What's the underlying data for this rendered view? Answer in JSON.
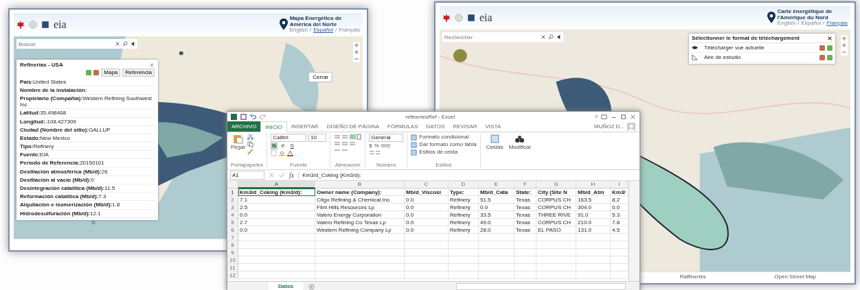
{
  "map_windows": [
    {
      "kind": "left",
      "logo_text": "eia",
      "title_lines": [
        "Mapa Energético de",
        "América del Norte"
      ],
      "language_separator": "/",
      "languages": [
        {
          "label": "English",
          "selected": false
        },
        {
          "label": "Español",
          "selected": true
        },
        {
          "label": "Français",
          "selected": false
        }
      ],
      "search": {
        "placeholder": "Buscar"
      },
      "info_panel": {
        "title": "Refinerías - USA",
        "buttons": [
          "Mapa",
          "Referencia"
        ],
        "fields": [
          {
            "label": "País:",
            "value": "United States"
          },
          {
            "label": "Nombre de la instalación:"
          },
          {
            "label": "Propietario (Compañía):",
            "value": "Western Refining Southwest Inc"
          },
          {
            "label": "Latitud:",
            "value": "35.498468"
          },
          {
            "label": "Longitud:",
            "value": "-108.427309"
          },
          {
            "label": "Ciudad (Nombre del sitio):",
            "value": "GALLUP"
          },
          {
            "label": "Estado:",
            "value": "New Mexico"
          },
          {
            "label": "Tipo:",
            "value": "Refinery"
          },
          {
            "label": "Fuente:",
            "value": "EIA"
          },
          {
            "label": "Período de Referencia:",
            "value": "20150101"
          },
          {
            "label": "Destilación atmosférica (Mb/d):",
            "value": "26"
          },
          {
            "label": "Destilación al vacío (Mb/d):",
            "value": "0"
          },
          {
            "label": "Desintegración catalítica (Mb/d):",
            "value": "11.5"
          },
          {
            "label": "Reformación catalítica (Mb/d):",
            "value": "7.3"
          },
          {
            "label": "Alquilación e isomerización (Mb/d):",
            "value": "1.8"
          },
          {
            "label": "Hidrodesulfuración (Mb/d):",
            "value": "12.1"
          }
        ]
      },
      "popup_button": "Cerrar"
    },
    {
      "kind": "right",
      "logo_text": "eia",
      "title_lines": [
        "Carte énergétique de",
        "l'Amérique du Nord"
      ],
      "language_separator": "/",
      "languages": [
        {
          "label": "English",
          "selected": false
        },
        {
          "label": "Español",
          "selected": false
        },
        {
          "label": "Français",
          "selected": true
        }
      ],
      "search": {
        "placeholder": "Rechercher"
      },
      "download_panel": {
        "title": "Sélectionner le format de téléchargement",
        "rows": [
          "Télécharger vue actuelle",
          "Aire de estudio"
        ]
      },
      "footer_tabs": [
        "Raffineries",
        "Open Street Map"
      ]
    }
  ],
  "spreadsheet": {
    "title": "refineriesRef - Excel",
    "help": "?",
    "ribbon_tabs": [
      {
        "label": "ARCHIVO",
        "kind": "file",
        "selected": false
      },
      {
        "label": "INICIO",
        "kind": "tab",
        "selected": true
      },
      {
        "label": "INSERTAR",
        "kind": "tab",
        "selected": false
      },
      {
        "label": "DISEÑO DE PÁGINA",
        "kind": "tab",
        "selected": false
      },
      {
        "label": "FÓRMULAS",
        "kind": "tab",
        "selected": false
      },
      {
        "label": "DATOS",
        "kind": "tab",
        "selected": false
      },
      {
        "label": "REVISAR",
        "kind": "tab",
        "selected": false
      },
      {
        "label": "VISTA",
        "kind": "tab",
        "selected": false
      }
    ],
    "user": "MUÑOZ D...",
    "ribbon": {
      "paste": "Pegar",
      "clipboard_label": "Portapapeles",
      "font_name": "Calibri",
      "font_size": "10",
      "font_styles": [
        {
          "label": "N",
          "on": true
        },
        {
          "label": "K",
          "on": false
        },
        {
          "label": "S",
          "on": false
        }
      ],
      "font_label": "Fuente",
      "alignment_label": "Alineación",
      "number_format": "General",
      "number_symbols": [
        "$",
        "%",
        "000"
      ],
      "number_label": "Número",
      "style_items": [
        "Formato condicional",
        "Dar formato como tabla",
        "Estilos de celda"
      ],
      "styles_label": "Estilos",
      "cells_label": "Celdas",
      "editing_label": "Modificar"
    },
    "name_box": "A1",
    "formula_label": "fx",
    "formula": "Km3/d_Coking (Km3/d):",
    "columns": [
      "A",
      "B",
      "C",
      "D",
      "E",
      "F",
      "G",
      "H",
      "I"
    ],
    "rows": [
      {
        "number": "1",
        "kind": "header",
        "cells": [
          "Km3/d_Coking (Km3/d):",
          "Owner name (Company):",
          "Mb/d_Viscosi",
          "Type:",
          "Mb/d_Cata",
          "State:",
          "City (Site N",
          "Mb/d_Atm",
          "Km3/"
        ]
      },
      {
        "number": "2",
        "kind": "data",
        "cells": [
          "7.1",
          "Citgo Refining & Chemical Inc",
          "0.0",
          "Refinery",
          "51.5",
          "Texas",
          "CORPUS CH",
          "163.5",
          "8.2"
        ]
      },
      {
        "number": "3",
        "kind": "data",
        "cells": [
          "2.5",
          "Flint Hills Resources Lp",
          "0.0",
          "Refinery",
          "0.0",
          "Texas",
          "CORPUS CH",
          "304.0",
          "0.0"
        ]
      },
      {
        "number": "4",
        "kind": "data",
        "cells": [
          "0.0",
          "Valero Energy Corporation",
          "0.0",
          "Refinery",
          "33.5",
          "Texas",
          "THREE RIVE",
          "91.0",
          "5.3"
        ]
      },
      {
        "number": "5",
        "kind": "data",
        "cells": [
          "2.7",
          "Valero Refining Co Texas Lp",
          "0.0",
          "Refinery",
          "49.0",
          "Texas",
          "CORPUS CH",
          "210.0",
          "7.8"
        ]
      },
      {
        "number": "6",
        "kind": "data",
        "cells": [
          "0.0",
          "Western Refining Company Lp",
          "0.0",
          "Refinery",
          "28.0",
          "Texas",
          "EL PASO",
          "131.0",
          "4.5"
        ]
      },
      {
        "number": "7",
        "kind": "data",
        "cells": []
      },
      {
        "number": "8",
        "kind": "data",
        "cells": []
      },
      {
        "number": "9",
        "kind": "data",
        "cells": []
      },
      {
        "number": "10",
        "kind": "data",
        "cells": []
      },
      {
        "number": "11",
        "kind": "data",
        "cells": []
      },
      {
        "number": "12",
        "kind": "data",
        "cells": []
      }
    ],
    "sheet_tabs": [
      {
        "label": "Datos",
        "selected": true
      }
    ]
  }
}
